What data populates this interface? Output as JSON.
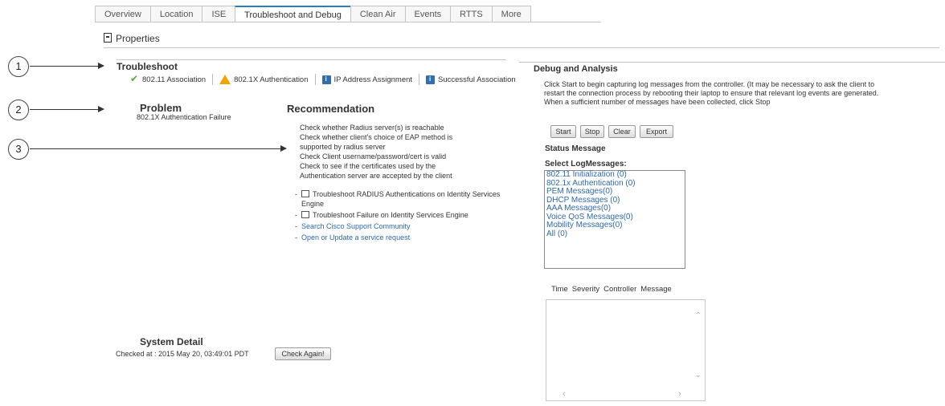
{
  "tabs": [
    "Overview",
    "Location",
    "ISE",
    "Troubleshoot and Debug",
    "Clean Air",
    "Events",
    "RTTS",
    "More"
  ],
  "properties_label": "Properties",
  "callouts": [
    "1",
    "2",
    "3"
  ],
  "troubleshoot": {
    "title": "Troubleshoot",
    "steps": [
      {
        "label": "802.11 Association",
        "icon": "check-icon"
      },
      {
        "label": "802.1X Authentication",
        "icon": "warning-icon"
      },
      {
        "label": "IP Address Assignment",
        "icon": "info-icon"
      },
      {
        "label": "Successful Association",
        "icon": "info-icon"
      }
    ]
  },
  "problem": {
    "title": "Problem",
    "text": "802.1X Authentication Failure"
  },
  "recommendation": {
    "title": "Recommendation",
    "lines": [
      "Check whether Radius server(s) is reachable",
      "Check whether client's choice of EAP method is",
      "supported by radius server",
      "Check Client username/password/cert is valid",
      "Check to see if the certificates used by the",
      "Authentication server are accepted by the client"
    ],
    "links": [
      {
        "text": "Troubleshoot RADIUS Authentications on Identity Services Engine",
        "ext": true
      },
      {
        "text": "Troubleshoot Failure on Identity Services Engine",
        "ext": true
      },
      {
        "text": "Search Cisco Support Community",
        "ext": false
      },
      {
        "text": "Open or Update a service request",
        "ext": false
      }
    ]
  },
  "system_detail": {
    "title": "System Detail",
    "checked": "Checked at : 2015 May 20, 03:49:01 PDT",
    "check_again": "Check Again!"
  },
  "debug": {
    "title": "Debug and Analysis",
    "intro": [
      "Click Start to begin capturing log messages from the controller. (It may be necessary to ask the client to",
      "restart the connection process by rebooting their laptop to ensure that relevant log events are generated.",
      "When a sufficient number of messages have been collected, click Stop"
    ],
    "buttons": {
      "start": "Start",
      "stop": "Stop",
      "clear": "Clear",
      "export": "Export"
    },
    "status_message": "Status Message",
    "select_log": "Select LogMessages:",
    "log_items": [
      "802.11 Initialization (0)",
      "802.1x Authentication (0)",
      "PEM Messages(0)",
      "DHCP Messages (0)",
      "AAA Messages(0)",
      "Voice QoS Messages(0)",
      "Mobility Messages(0)",
      "All (0)"
    ],
    "table_headers": [
      "Time",
      "Severity",
      "Controller",
      "Message"
    ]
  }
}
